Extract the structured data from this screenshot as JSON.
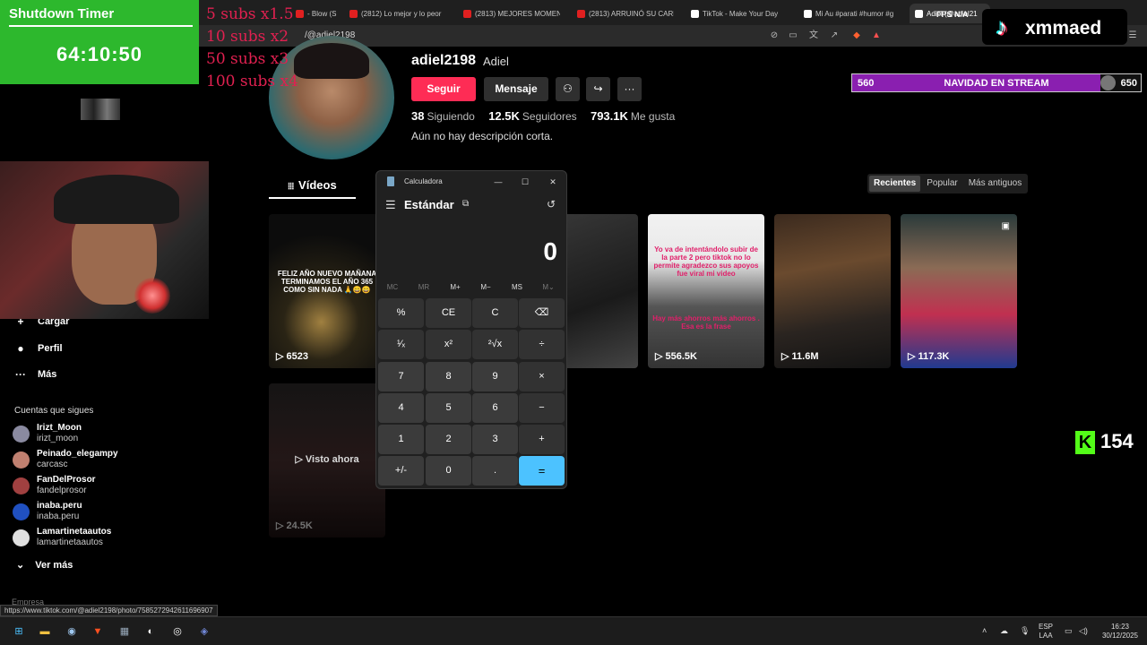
{
  "browser": {
    "tabs": [
      {
        "label": "- Blow (S",
        "color": "#e02020"
      },
      {
        "label": "(2812) Lo mejor y lo peor",
        "color": "#e02020"
      },
      {
        "label": "(2813) MEJORES MOMENT",
        "color": "#e02020"
      },
      {
        "label": "(2813) ARRUINÓ SU CARR",
        "color": "#e02020"
      },
      {
        "label": "TikTok - Make Your Day",
        "color": "#ffffff"
      },
      {
        "label": "Mi Au #parati #humor #g",
        "color": "#ffffff"
      },
      {
        "label": "Adiel (@adiel21",
        "color": "#ffffff"
      }
    ],
    "url": "/@adiel2198",
    "fps_label": "FPS N/A"
  },
  "overlay": {
    "timer_title": "Shutdown Timer",
    "timer_value": "64:10:50",
    "subs_lines": [
      "5 subs x1.5",
      "10 subs x2",
      "50 subs x3",
      "100 subs x4"
    ],
    "channel_name": "xmmaed",
    "goal": {
      "left": "560",
      "center": "NAVIDAD EN STREAM",
      "right": "650",
      "progress": 0.86
    },
    "kick_count": "154"
  },
  "profile": {
    "username": "adiel2198",
    "display_name": "Adiel",
    "follow_label": "Seguir",
    "message_label": "Mensaje",
    "following_count": "38",
    "following_label": "Siguiendo",
    "followers_count": "12.5K",
    "followers_label": "Seguidores",
    "likes_count": "793.1K",
    "likes_label": "Me gusta",
    "bio": "Aún no hay descripción corta."
  },
  "videos_tab": "Vídeos",
  "sort_options": [
    "Recientes",
    "Popular",
    "Más antiguos"
  ],
  "videos": [
    {
      "views": "6523",
      "overlay": "FELIZ AÑO NUEVO MAÑANA TERMINAMOS EL AÑO 365 COMO SIN NADA 🙏😀😀"
    },
    {
      "views": "",
      "overlay": ""
    },
    {
      "views": "556.5K",
      "overlay_top": "Yo va de intentándolo subir de la parte 2 pero tiktok no lo permite agradezco sus apoyos fue viral mi video",
      "overlay_bottom": "Hay más ahorros más ahorros . Esa es la frase"
    },
    {
      "views": "11.6M",
      "overlay": ""
    },
    {
      "views": "117.3K",
      "overlay": ""
    },
    {
      "views": "24.5K",
      "overlay": "Visto ahora"
    }
  ],
  "sidebar": {
    "items": [
      {
        "label": "Cargar",
        "icon": "+"
      },
      {
        "label": "Perfil",
        "icon": "●"
      },
      {
        "label": "Más",
        "icon": "···"
      }
    ],
    "following_title": "Cuentas que sigues",
    "accounts": [
      {
        "name": "Irizt_Moon",
        "handle": "irizt_moon",
        "color": "#8a8aa0"
      },
      {
        "name": "Peinado_elegampy",
        "handle": "carcasc",
        "color": "#c08070"
      },
      {
        "name": "FanDelProsor",
        "handle": "fandelprosor",
        "color": "#a04040"
      },
      {
        "name": "inaba.peru",
        "handle": "inaba.peru",
        "color": "#2050c0"
      },
      {
        "name": "Lamartinetaautos",
        "handle": "lamartinetaautos",
        "color": "#e0e0e0"
      }
    ],
    "see_more": "Ver más",
    "company": "Empresa"
  },
  "status_url": "https://www.tiktok.com/@adiel2198/photo/7585272942611696907",
  "calculator": {
    "title": "Calculadora",
    "mode": "Estándar",
    "display": "0",
    "memory": [
      "MC",
      "MR",
      "M+",
      "M−",
      "MS",
      "M⌄"
    ],
    "keys": [
      [
        "%",
        "CE",
        "C",
        "⌫"
      ],
      [
        "¹⁄ₓ",
        "x²",
        "²√x",
        "÷"
      ],
      [
        "7",
        "8",
        "9",
        "×"
      ],
      [
        "4",
        "5",
        "6",
        "−"
      ],
      [
        "1",
        "2",
        "3",
        "+"
      ],
      [
        "+/-",
        "0",
        ".",
        "="
      ]
    ]
  },
  "taskbar": {
    "lang_top": "ESP",
    "lang_bottom": "LAA",
    "time": "16:23",
    "date": "30/12/2025"
  }
}
